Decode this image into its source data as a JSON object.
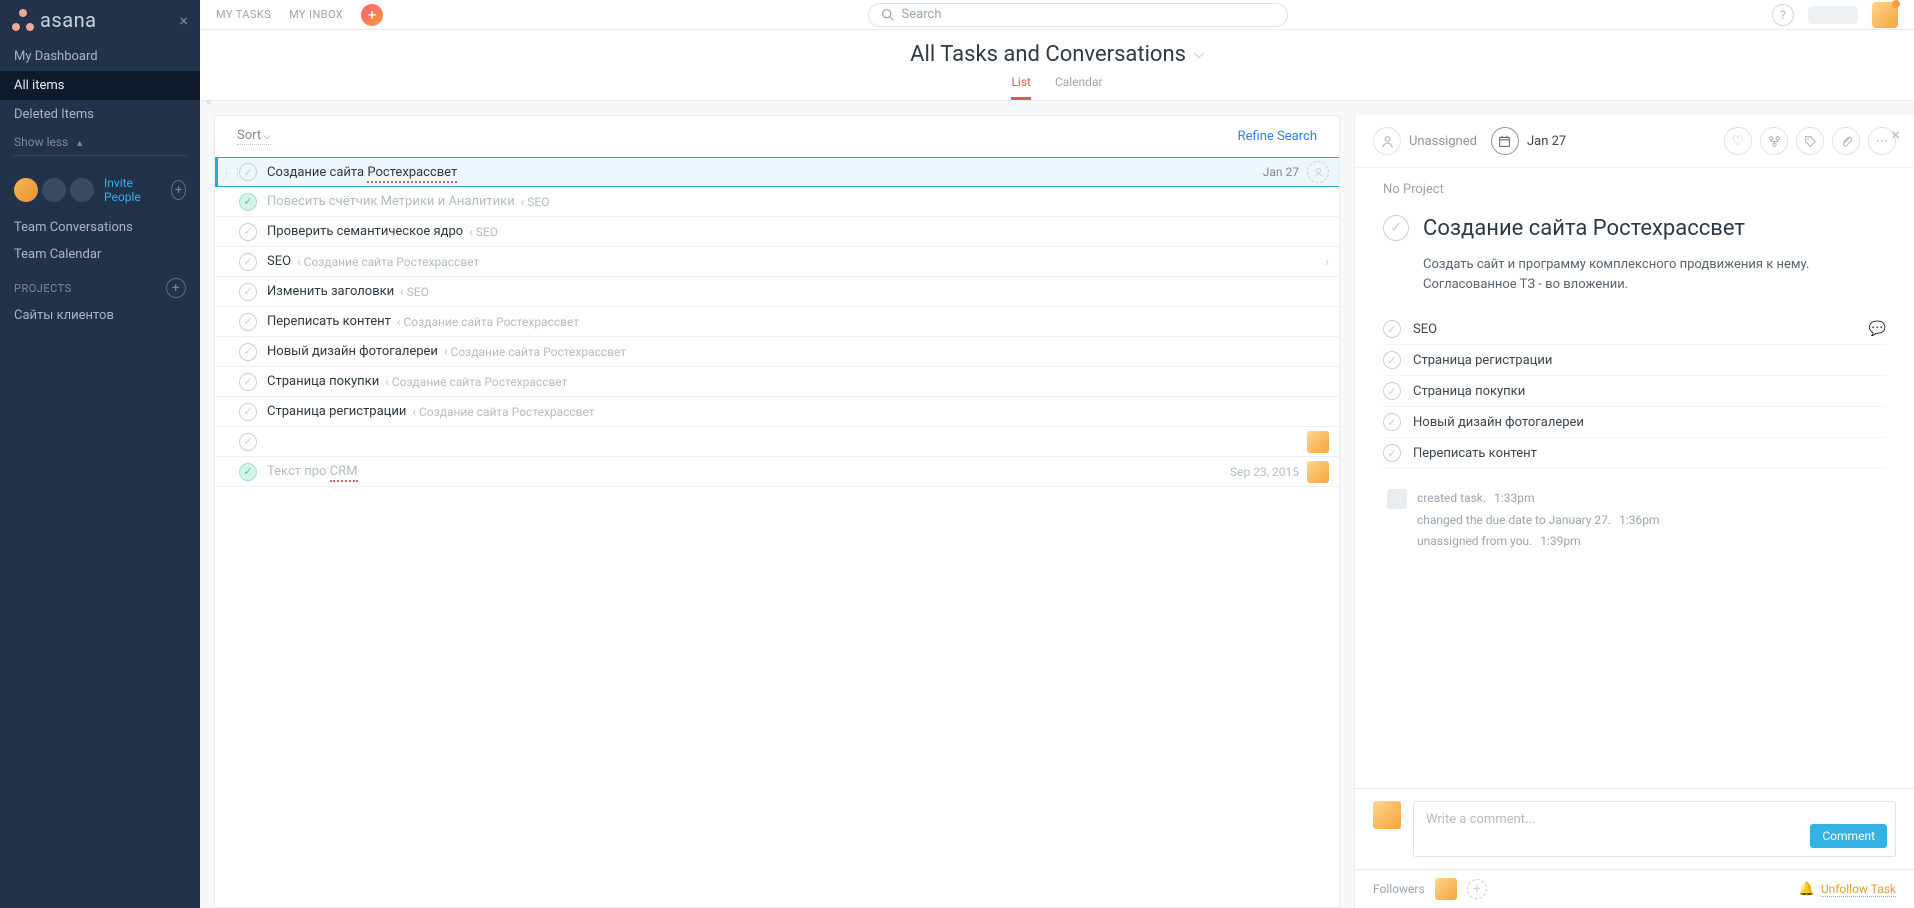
{
  "brand": "asana",
  "topnav": {
    "my_tasks": "MY TASKS",
    "my_inbox": "MY INBOX",
    "search_placeholder": "Search"
  },
  "sidebar": {
    "items": [
      {
        "label": "My Dashboard"
      },
      {
        "label": "All items"
      },
      {
        "label": "Deleted Items"
      }
    ],
    "show_less": "Show less",
    "invite": "Invite People",
    "team_conversations": "Team Conversations",
    "team_calendar": "Team Calendar",
    "projects_header": "PROJECTS",
    "project_0": "Сайты клиентов"
  },
  "header": {
    "title": "All Tasks and Conversations",
    "tab_list": "List",
    "tab_calendar": "Calendar"
  },
  "list": {
    "sort": "Sort",
    "refine": "Refine Search",
    "tasks": [
      {
        "title": "Создание сайта Ростехрассвет",
        "sub": "",
        "done": false,
        "due": "Jan 27",
        "selected": true,
        "underline": true,
        "assignee_placeholder": true
      },
      {
        "title": "Повесить счётчик Метрики и Аналитики",
        "sub": "‹ SEO",
        "done": true
      },
      {
        "title": "Проверить семантическое ядро",
        "sub": "‹ SEO",
        "done": false
      },
      {
        "title": "SEO",
        "sub": "‹ Создание сайта Ростехрассвет",
        "done": false,
        "chevron": true
      },
      {
        "title": "Изменить заголовки",
        "sub": "‹ SEO",
        "done": false
      },
      {
        "title": "Переписать контент",
        "sub": "‹ Создание сайта Ростехрассвет",
        "done": false
      },
      {
        "title": "Новый дизайн фотогалереи",
        "sub": "‹ Создание сайта Ростехрассвет",
        "done": false
      },
      {
        "title": "Страница покупки",
        "sub": "‹ Создание сайта Ростехрассвет",
        "done": false
      },
      {
        "title": "Страница регистрации",
        "sub": "‹ Создание сайта Ростехрассвет",
        "done": false
      },
      {
        "title": "",
        "sub": "",
        "done": false,
        "assignee_square": true
      },
      {
        "title": "Текст про CRM",
        "sub": "",
        "done": true,
        "due": "Sep 23, 2015",
        "underline_word": "CRM",
        "assignee_square": true
      }
    ]
  },
  "detail": {
    "unassigned": "Unassigned",
    "date": "Jan 27",
    "no_project": "No Project",
    "title": "Создание сайта Ростехрассвет",
    "description": "Создать сайт и программу комплексного продвижения к нему. Согласованное ТЗ - во вложении.",
    "subtasks": [
      {
        "title": "SEO",
        "comment_icon": true
      },
      {
        "title": "Страница регистрации"
      },
      {
        "title": "Страница покупки"
      },
      {
        "title": "Новый дизайн фотогалереи"
      },
      {
        "title": "Переписать контент"
      }
    ],
    "activity": [
      {
        "text": "created task.",
        "time": "1:33pm"
      },
      {
        "text": "changed the due date to January 27.",
        "time": "1:36pm"
      },
      {
        "text": "unassigned from you.",
        "time": "1:39pm"
      }
    ],
    "comment_placeholder": "Write a comment...",
    "comment_button": "Comment",
    "followers_label": "Followers",
    "unfollow": "Unfollow Task"
  }
}
